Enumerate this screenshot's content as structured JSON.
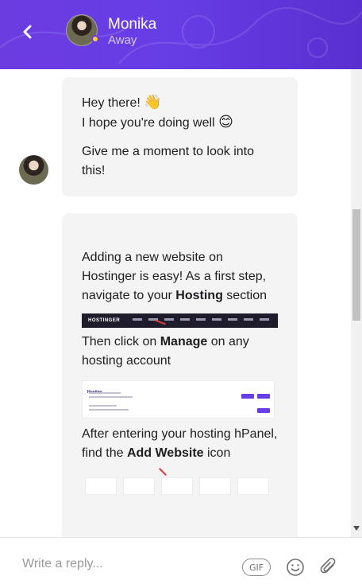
{
  "header": {
    "agent_name": "Monika",
    "agent_status": "Away",
    "accent_color": "#673de6",
    "status_color": "#ffcd35",
    "back_icon": "chevron-left-icon"
  },
  "messages": [
    {
      "line1": "Hey there!",
      "line1_emoji": "👋",
      "line2": "I hope you're doing well",
      "line2_emoji": "😊",
      "line3": "Give me a moment to look into this!"
    },
    {
      "p1_before": "Adding a new website on Hostinger is easy! As a first step, navigate to your ",
      "p1_bold": "Hosting",
      "p1_after": " section",
      "p2_before": "Then click on ",
      "p2_bold": "Manage",
      "p2_after": " on any hosting account",
      "p3_before": "After entering your hosting hPanel, find the ",
      "p3_bold": "Add Website",
      "p3_after": " icon",
      "screenshot1_logo": "HOSTINGER",
      "screenshot2_title": "Hosting"
    }
  ],
  "composer": {
    "placeholder": "Write a reply...",
    "gif_label": "GIF",
    "emoji_icon": "smiley-icon",
    "attach_icon": "paperclip-icon"
  }
}
